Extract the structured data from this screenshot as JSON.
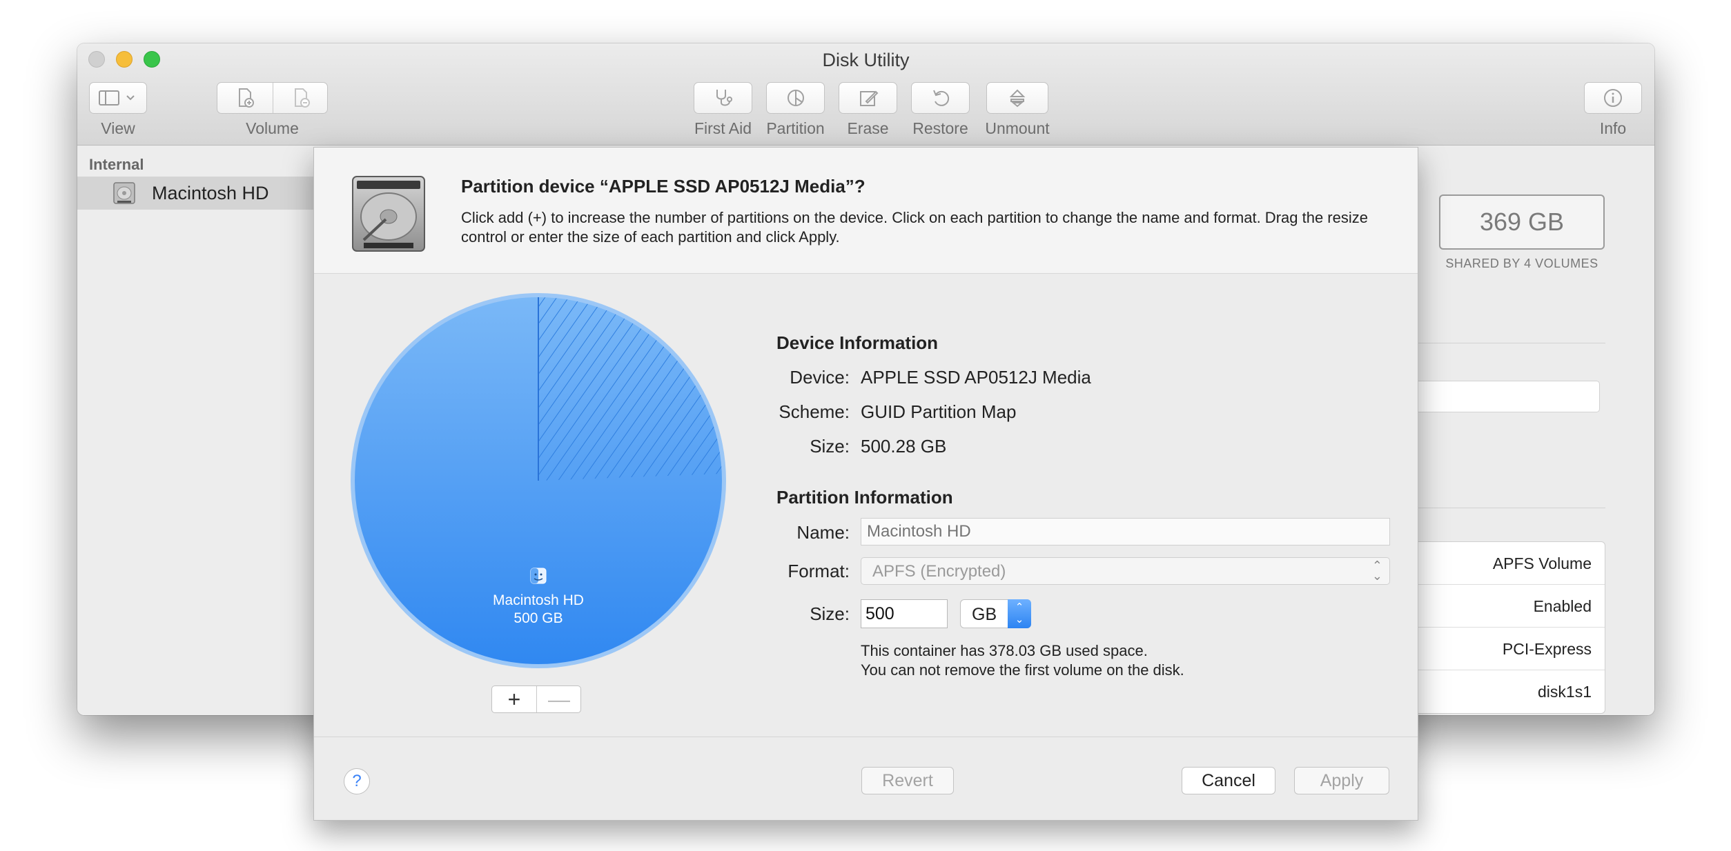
{
  "window": {
    "title": "Disk Utility"
  },
  "toolbar": {
    "view_label": "View",
    "volume_label": "Volume",
    "first_aid_label": "First Aid",
    "partition_label": "Partition",
    "erase_label": "Erase",
    "restore_label": "Restore",
    "unmount_label": "Unmount",
    "info_label": "Info"
  },
  "sidebar": {
    "section": "Internal",
    "items": [
      {
        "label": "Macintosh HD",
        "icon": "disk-icon",
        "selected": true
      }
    ]
  },
  "detail": {
    "capacity": "369 GB",
    "capacity_sub": "SHARED BY 4 VOLUMES",
    "rows": [
      "APFS Volume",
      "Enabled",
      "PCI-Express",
      "disk1s1"
    ]
  },
  "sheet": {
    "title": "Partition device “APPLE SSD AP0512J Media”?",
    "description": "Click add (+) to increase the number of partitions on the device. Click on each partition to change the name and format. Drag the resize control or enter the size of each partition and click Apply.",
    "pie": {
      "partition_name": "Macintosh HD",
      "partition_size": "500 GB",
      "used_fraction": 0.756,
      "color": "#4a9bf2"
    },
    "add_label": "+",
    "remove_label": "—",
    "device_info": {
      "heading": "Device Information",
      "device_label": "Device:",
      "device_value": "APPLE SSD AP0512J Media",
      "scheme_label": "Scheme:",
      "scheme_value": "GUID Partition Map",
      "size_label": "Size:",
      "size_value": "500.28 GB"
    },
    "partition_info": {
      "heading": "Partition Information",
      "name_label": "Name:",
      "name_placeholder": "Macintosh HD",
      "format_label": "Format:",
      "format_value": "APFS (Encrypted)",
      "size_label": "Size:",
      "size_value": "500",
      "unit_value": "GB",
      "note_line1": "This container has 378.03 GB used space.",
      "note_line2": "You can not remove the first volume on the disk."
    },
    "buttons": {
      "help": "?",
      "revert": "Revert",
      "cancel": "Cancel",
      "apply": "Apply"
    }
  }
}
